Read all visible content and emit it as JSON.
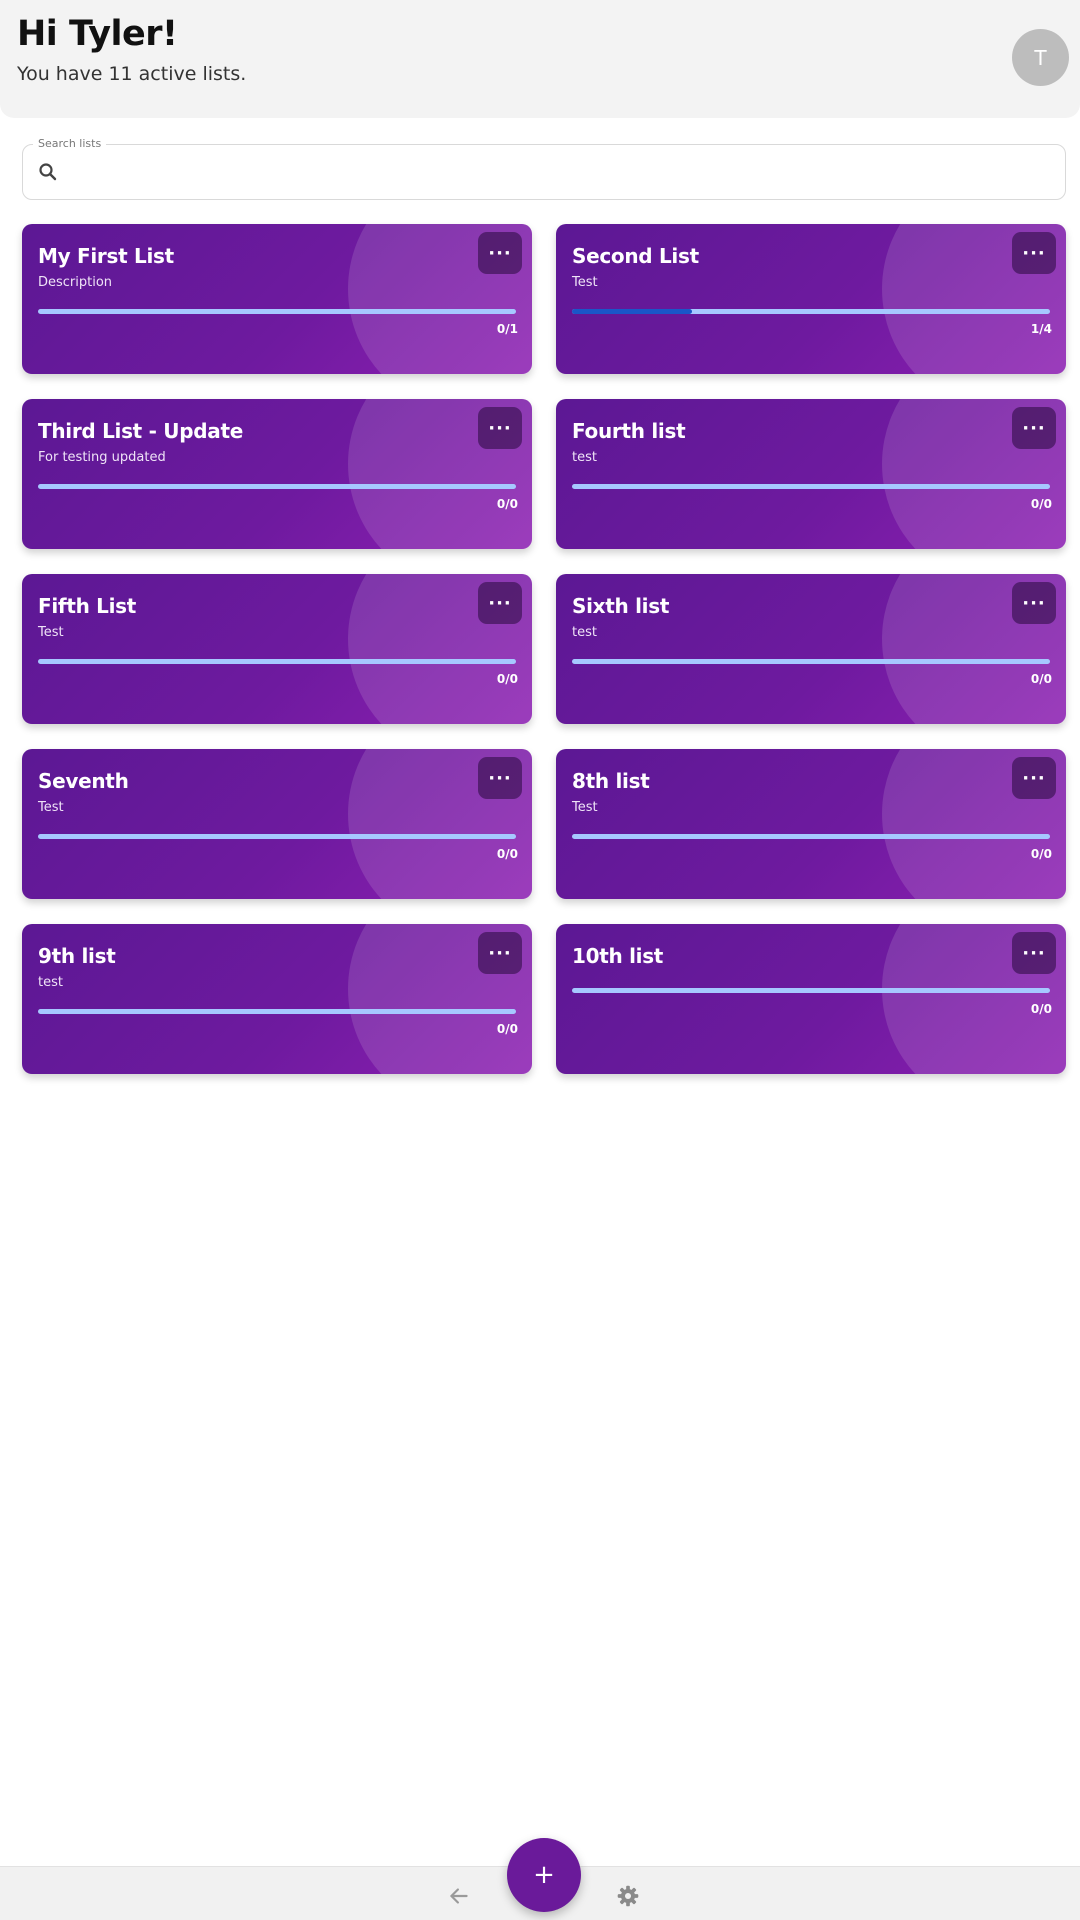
{
  "header": {
    "greeting": "Hi Tyler!",
    "subtitle": "You have 11 active lists.",
    "avatar_initial": "T"
  },
  "search": {
    "label": "Search lists",
    "value": ""
  },
  "lists": [
    {
      "title": "My First List",
      "description": "Description",
      "count": "0/1",
      "progress": 0
    },
    {
      "title": "Second List",
      "description": "Test",
      "count": "1/4",
      "progress": 0.25
    },
    {
      "title": "Third List - Update",
      "description": "For testing updated",
      "count": "0/0",
      "progress": 0
    },
    {
      "title": "Fourth list",
      "description": "test",
      "count": "0/0",
      "progress": 0
    },
    {
      "title": "Fifth List",
      "description": "Test",
      "count": "0/0",
      "progress": 0
    },
    {
      "title": "Sixth list",
      "description": "test",
      "count": "0/0",
      "progress": 0
    },
    {
      "title": "Seventh",
      "description": "Test",
      "count": "0/0",
      "progress": 0
    },
    {
      "title": "8th list",
      "description": "Test",
      "count": "0/0",
      "progress": 0
    },
    {
      "title": "9th list",
      "description": "test",
      "count": "0/0",
      "progress": 0
    },
    {
      "title": "10th list",
      "description": "",
      "count": "0/0",
      "progress": 0
    }
  ],
  "card_menu_label": "···",
  "fab_label": "+",
  "colors": {
    "card_start": "#5c1894",
    "card_end": "#8d1fb2",
    "progress_track": "#a6c8ff",
    "progress_fill": "#1a56c8",
    "fab": "#6a1a9a"
  },
  "icons": {
    "search": "search-icon",
    "back": "arrow-left-icon",
    "settings": "gear-icon",
    "menu": "more-horizontal-icon",
    "add": "plus-icon"
  }
}
